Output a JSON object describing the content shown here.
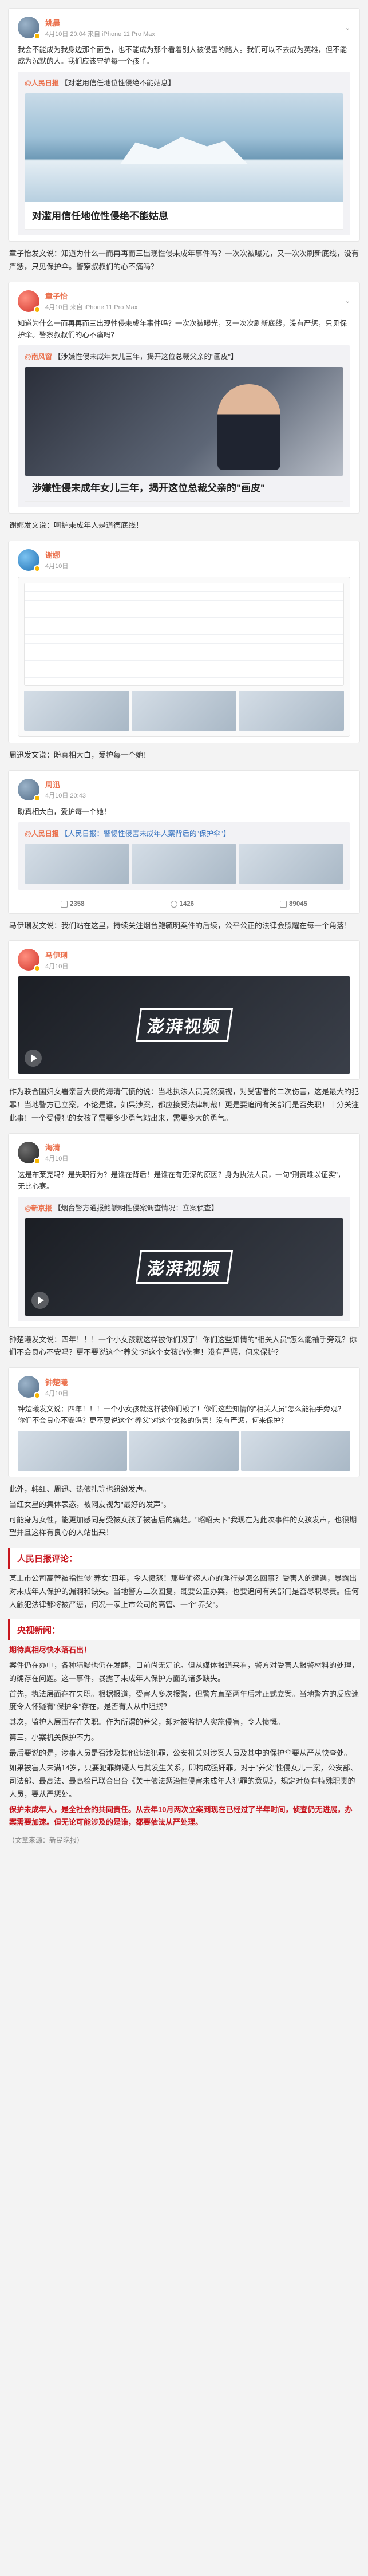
{
  "posts": [
    {
      "user": "姚晨",
      "meta": "4月10日 20:04 来自 iPhone 11 Pro Max",
      "text": "我会不能成为我身边那个面色，也不能成为那个看着别人被侵害的路人。我们可以不去成为英雄，但不能成为沉默的人。我们应该守护每一个孩子。",
      "repost_user": "@人民日报",
      "repost_text": "【对滥用信任地位性侵绝不能姑息】",
      "caption": "对滥用信任地位性侵绝不能姑息"
    }
  ],
  "comment1": "章子怡发文说：知道为什么一而再再而三出现性侵未成年事件吗？一次次被曝光，又一次次刷新底线，没有严惩，只见保护伞。警察叔叔们的心不痛吗？",
  "post2": {
    "user": "章子怡",
    "meta": "4月10日 来自 iPhone 11 Pro Max",
    "text": "知道为什么一而再再而三出现性侵未成年事件吗？一次次被曝光，又一次次刷新底线，没有严惩，只见保护伞。警察叔叔们的心不痛吗？",
    "repost_user": "@南风窗",
    "repost_text": "【涉嫌性侵未成年女儿三年，揭开这位总裁父亲的\"画皮\"】",
    "caption": "涉嫌性侵未成年女儿三年，揭开这位总裁父亲的\"画皮\""
  },
  "comment2": "谢娜发文说：呵护未成年人是道德底线！",
  "comment3": "周迅发文说：盼真相大白，爱护每一个她！",
  "post4": {
    "user": "周迅",
    "meta": "4月10日 20:43",
    "text": "盼真相大白，爱护每一个她！",
    "repost_user": "@人民日报",
    "repost_text": "【人民日报：警惕性侵害未成年人案背后的\"保护伞\"】"
  },
  "comment4": "马伊琍发文说：我们站在这里，持续关注烟台鲍毓明案件的后续，公平公正的法律会照耀在每一个角落！",
  "comment5": "作为联合国妇女署亲善大使的海清气愤的说：当地执法人员竟然漠视，对受害者的二次伤害，这是最大的犯罪！当地警方已立案，不论是谁，如果涉案，都应接受法律制裁！更是要追问有关部门是否失职！十分关注此事！一个受侵犯的女孩子需要多少勇气站出来，需要多大的勇气。",
  "post6": {
    "user": "海清",
    "meta": "4月10日",
    "text": "这是布莱克吗？是失职行为？是谁在背后！是谁在有更深的原因？身为执法人员，一句\"刑责难以证实\"，无比心寒。",
    "repost_user": "@新京报",
    "repost_text": "【烟台警方通报鲍毓明性侵案调查情况：立案侦查】"
  },
  "comment6": "钟楚曦发文说：四年！！！一个小女孩就这样被你们毁了！你们这些知情的\"相关人员\"怎么能袖手旁观？你们不会良心不安吗？更不要说这个\"养父\"对这个女孩的伤害！没有严惩，何来保护？",
  "comment7": "此外，韩红、周迅、热依扎等也纷纷发声。",
  "comment8": "当红女星的集体表态，被网友视为\"最好的发声\"。",
  "comment9": "可能身为女性，能更加感同身受被女孩子被害后的痛楚。\"昭昭天下\"我现在为此次事件的女孩发声，也很期望并且这样有良心的人站出来！",
  "section1": "人民日报评论：",
  "rmrb": "某上市公司高管被指性侵\"养女\"四年，令人愤怒！那些偷盗人心的淫行是怎么回事？受害人的遭遇，暴露出对未成年人保护的漏洞和缺失。当地警方二次回复，既要公正办案，也要追问有关部门是否尽职尽责。任何人触犯法律都将被严惩，何况一家上市公司的高管、一个\"养父\"。",
  "section2": "央视新闻：",
  "section3": "期待真相尽快水落石出！",
  "cctv1": "案件仍在办中，各种猜疑也仍在发酵，目前尚无定论。但从媒体报道来看，警方对受害人报警材料的处理，的确存在问题。这一事件，暴露了未成年人保护方面的诸多缺失。",
  "cctv2": "首先，执法层面存在失职。根据报道，受害人多次报警，但警方直至两年后才正式立案。当地警方的反应速度令人怀疑有\"保护伞\"存在，是否有人从中阻挠？",
  "cctv3": "其次，监护人层面存在失职。作为所谓的养父，却对被监护人实施侵害，令人愤慨。",
  "cctv4": "第三，小案机关保护不力。",
  "cctv5": "最后要说的是，涉事人员是否涉及其他违法犯罪，公安机关对涉案人员及其中的保护伞要从严从快查处。",
  "cctv6": "如果被害人未满14岁，只要犯罪嫌疑人与其发生关系，即构成强奸罪。对于\"养父\"性侵女儿一案，公安部、司法部、最高法、最高检已联合出台《关于依法惩治性侵害未成年人犯罪的意见》，规定对负有特殊职责的人员，要从严惩处。",
  "cctv7": "保护未成年人，是全社会的共同责任。从去年10月两次立案到现在已经过了半年时间，侦查仍无进展，办案需要加速。但无论可能涉及的是谁，都要依法从严处理。",
  "footer": "（文章来源：新民晚报）",
  "actions": {
    "repost": "转发",
    "comment": "评论",
    "like": "赞"
  },
  "counts": {
    "a": "2358",
    "b": "1426",
    "c": "89045"
  }
}
